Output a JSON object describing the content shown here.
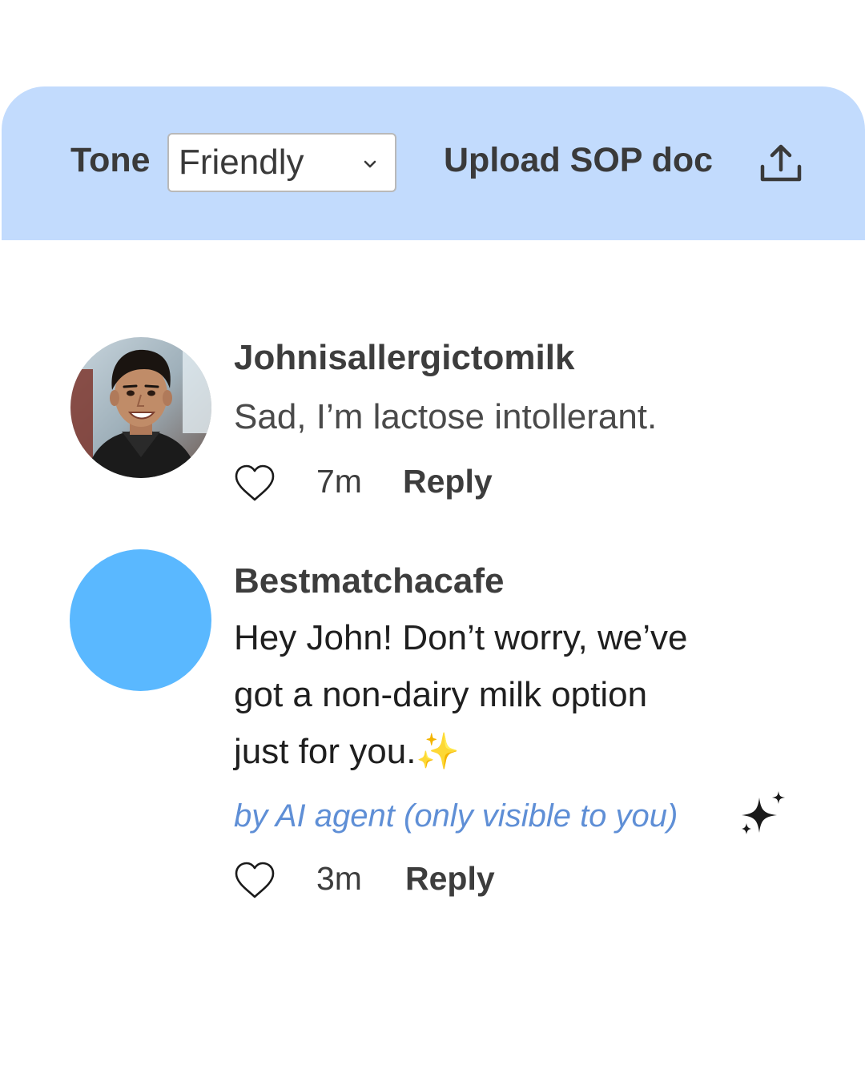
{
  "toolbar": {
    "tone_label": "Tone",
    "tone_selected": "Friendly",
    "upload_label": "Upload SOP doc",
    "upload_icon": "upload-icon",
    "background_color": "#c2dbfd"
  },
  "comments": [
    {
      "username": "Johnisallergictomilk",
      "text": "Sad, I’m lactose intollerant.",
      "time": "7m",
      "reply_label": "Reply",
      "avatar": "profile-photo"
    },
    {
      "username": "Bestmatchacafe",
      "text_lines": [
        "Hey John! Don’t worry, we’ve",
        "got a non-dairy milk option",
        "just for you.✨"
      ],
      "ai_note": "by AI agent (only visible to you)",
      "time": "3m",
      "reply_label": "Reply",
      "avatar_color": "#5ab8ff"
    }
  ],
  "icons": {
    "like": "heart-icon",
    "ai": "sparkle-icon",
    "dropdown": "chevron-down-icon"
  },
  "colors": {
    "accent_blue": "#5ab8ff",
    "ai_note": "#5f8fd6",
    "text": "#3d3d3d"
  }
}
